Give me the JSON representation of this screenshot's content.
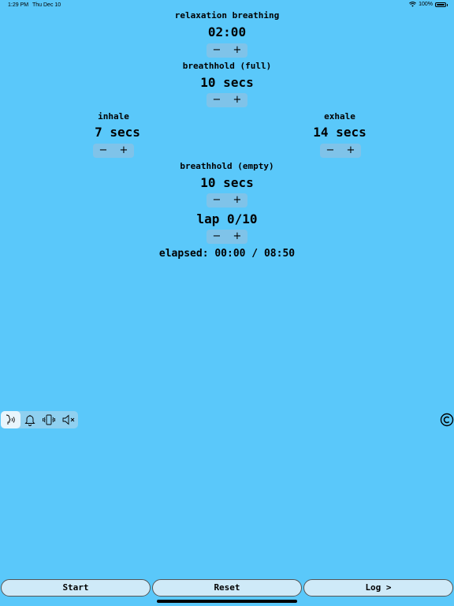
{
  "status_bar": {
    "time": "1:29 PM",
    "date": "Thu Dec 10",
    "battery": "100%"
  },
  "session": {
    "label": "relaxation breathing",
    "value": "02:00"
  },
  "breathhold_full": {
    "label": "breathhold (full)",
    "value": "10 secs"
  },
  "inhale": {
    "label": "inhale",
    "value": "7 secs"
  },
  "exhale": {
    "label": "exhale",
    "value": "14 secs"
  },
  "breathhold_empty": {
    "label": "breathhold (empty)",
    "value": "10 secs"
  },
  "lap": {
    "value": "lap 0/10"
  },
  "elapsed": {
    "value": "elapsed: 00:00 / 08:50"
  },
  "stepper": {
    "minus": "−",
    "plus": "+"
  },
  "sound_modes": [
    "voice-icon",
    "bell-icon",
    "vibrate-icon",
    "mute-icon"
  ],
  "sound_mode_selected": "voice-icon",
  "copyright_icon": "copyright-icon",
  "buttons": {
    "start": "Start",
    "reset": "Reset",
    "log": "Log >"
  }
}
